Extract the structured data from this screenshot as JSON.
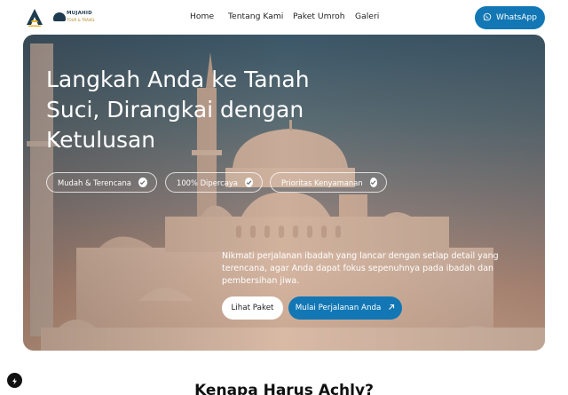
{
  "header": {
    "brand_text_line1": "MUJAHID",
    "brand_text_line2": "TOUR & TRAVEL",
    "nav": [
      "Home",
      "Tentang Kami",
      "Paket Umroh",
      "Galeri"
    ],
    "whatsapp_label": "WhatsApp"
  },
  "hero": {
    "title": "Langkah Anda ke Tanah Suci, Dirangkai dengan Ketulusan",
    "badges": [
      "Mudah & Terencana",
      "100% Dipercaya",
      "Prioritas Kenyamanan"
    ],
    "description": "Nikmati perjalanan ibadah yang lancar dengan setiap detail yang terencana, agar Anda dapat fokus sepenuhnya pada ibadah dan pembersihan jiwa.",
    "primary_button": "Lihat Paket",
    "secondary_button": "Mulai Perjalanan Anda"
  },
  "section": {
    "title": "Kenapa Harus Achly?"
  },
  "colors": {
    "accent": "#1277b4",
    "logo_navy": "#1e3b4f",
    "logo_gold": "#b08a2b"
  },
  "icons": {
    "whatsapp": "whatsapp-icon",
    "check": "check-circle-icon",
    "arrow": "arrow-up-right-icon",
    "floating": "bolt-icon"
  }
}
